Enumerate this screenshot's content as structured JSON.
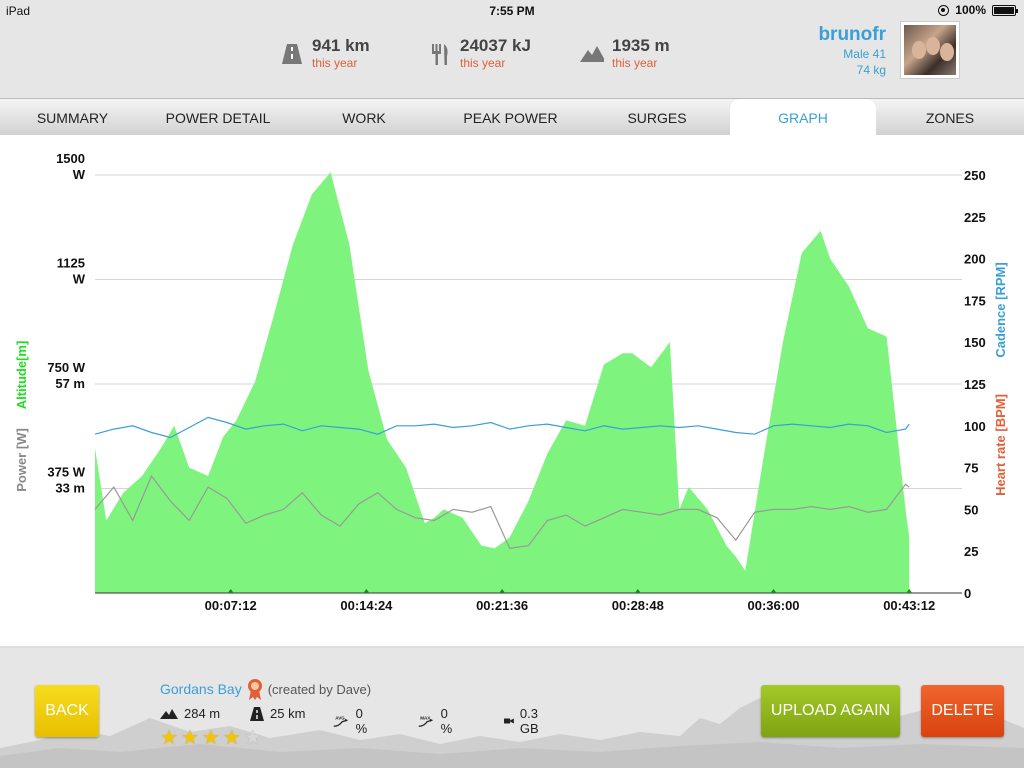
{
  "status_bar": {
    "device": "iPad",
    "time": "7:55 PM",
    "battery": "100%"
  },
  "header": {
    "stats": [
      {
        "icon": "road-icon",
        "value": "941 km",
        "sub": "this year"
      },
      {
        "icon": "fork-knife-icon",
        "value": "24037 kJ",
        "sub": "this year"
      },
      {
        "icon": "mountain-icon",
        "value": "1935 m",
        "sub": "this year"
      }
    ],
    "user": {
      "name": "brunofr",
      "line1": "Male 41",
      "line2": "74 kg"
    }
  },
  "tabs": [
    {
      "label": "SUMMARY",
      "active": false
    },
    {
      "label": "POWER DETAIL",
      "active": false
    },
    {
      "label": "WORK",
      "active": false
    },
    {
      "label": "PEAK POWER",
      "active": false
    },
    {
      "label": "SURGES",
      "active": false
    },
    {
      "label": "GRAPH",
      "active": true
    },
    {
      "label": "ZONES",
      "active": false
    }
  ],
  "chart_data": {
    "type": "area",
    "left_axis": {
      "titles": [
        {
          "text": "Altitude[m]",
          "color": "#22dd22"
        },
        {
          "text": "Power [W]",
          "color": "#888888"
        }
      ],
      "ticks": [
        {
          "value": 0,
          "labels": []
        },
        {
          "value": 375,
          "labels": [
            "375 W",
            "33 m"
          ]
        },
        {
          "value": 750,
          "labels": [
            "750 W",
            "57 m"
          ]
        },
        {
          "value": 1125,
          "labels": [
            "1125",
            "W"
          ]
        },
        {
          "value": 1500,
          "labels": [
            "1500",
            "W"
          ]
        }
      ],
      "ylim": [
        0,
        1500
      ]
    },
    "right_axis": {
      "titles": [
        {
          "text": "Cadence [RPM]",
          "color": "#3a9fd6"
        },
        {
          "text": "Heart rate [BPM]",
          "color": "#e0603a"
        }
      ],
      "ticks": [
        "0",
        "25",
        "50",
        "75",
        "100",
        "125",
        "150",
        "175",
        "200",
        "225",
        "250"
      ],
      "ylim": [
        0,
        250
      ]
    },
    "x_ticks": [
      "00:07:12",
      "00:14:24",
      "00:21:36",
      "00:28:48",
      "00:36:00",
      "00:43:12"
    ],
    "x_tick_minutes": [
      7.2,
      14.4,
      21.6,
      28.8,
      36.0,
      43.2
    ],
    "xlim_minutes": [
      0,
      46.0
    ],
    "grid": true,
    "series": [
      {
        "name": "Altitude",
        "kind": "area",
        "color": "#7ef47e",
        "scale": "left",
        "x_minutes": [
          0,
          0.6,
          1.5,
          2.5,
          3.5,
          4.2,
          5.0,
          6.0,
          6.8,
          7.5,
          8.5,
          9.5,
          10.5,
          11.5,
          12.5,
          13.5,
          14.5,
          15.5,
          16.5,
          17.5,
          18.0,
          18.5,
          19.5,
          20.5,
          21.2,
          22.0,
          23.0,
          24.0,
          25.0,
          26.0,
          27.0,
          28.0,
          28.5,
          29.5,
          30.5,
          31.0,
          31.5,
          32.5,
          33.5,
          34.0,
          34.5,
          35.5,
          36.5,
          37.5,
          38.5,
          39.0,
          40.0,
          41.0,
          42.0,
          43.0,
          43.2
        ],
        "y_watt_scale": [
          520,
          260,
          360,
          420,
          520,
          600,
          450,
          420,
          560,
          620,
          760,
          1000,
          1250,
          1430,
          1510,
          1250,
          800,
          550,
          450,
          250,
          270,
          300,
          270,
          170,
          160,
          200,
          330,
          500,
          620,
          600,
          820,
          860,
          860,
          810,
          900,
          300,
          380,
          300,
          170,
          130,
          80,
          500,
          900,
          1220,
          1300,
          1200,
          1100,
          950,
          920,
          300,
          200
        ]
      },
      {
        "name": "Cadence",
        "kind": "line",
        "color": "#3a9fd6",
        "scale": "right",
        "x_minutes": [
          0,
          1,
          2,
          3,
          4,
          5,
          6,
          7,
          8,
          9,
          10,
          11,
          12,
          13,
          14,
          15,
          16,
          17,
          18,
          19,
          20,
          21,
          22,
          23,
          24,
          25,
          26,
          27,
          28,
          29,
          30,
          31,
          32,
          33,
          34,
          35,
          36,
          37,
          38,
          39,
          40,
          41,
          42,
          43,
          43.2
        ],
        "y": [
          95,
          98,
          100,
          96,
          93,
          99,
          105,
          102,
          98,
          100,
          101,
          97,
          100,
          99,
          98,
          95,
          100,
          100,
          101,
          99,
          100,
          102,
          98,
          100,
          101,
          99,
          97,
          100,
          98,
          99,
          100,
          99,
          100,
          98,
          96,
          95,
          100,
          101,
          100,
          99,
          101,
          100,
          96,
          98,
          101
        ]
      },
      {
        "name": "Power",
        "kind": "line",
        "color": "#999999",
        "scale": "left",
        "x_minutes": [
          0,
          1,
          2,
          3,
          4,
          5,
          6,
          7,
          8,
          9,
          10,
          11,
          12,
          13,
          14,
          15,
          16,
          17,
          18,
          19,
          20,
          21,
          22,
          23,
          24,
          25,
          26,
          27,
          28,
          29,
          30,
          31,
          32,
          33,
          34,
          35,
          36,
          37,
          38,
          39,
          40,
          41,
          42,
          43,
          43.2
        ],
        "y": [
          300,
          380,
          260,
          420,
          330,
          260,
          380,
          340,
          250,
          280,
          300,
          360,
          280,
          240,
          320,
          360,
          300,
          270,
          260,
          300,
          290,
          310,
          160,
          170,
          260,
          280,
          240,
          270,
          300,
          290,
          280,
          300,
          300,
          270,
          190,
          290,
          300,
          300,
          310,
          300,
          310,
          290,
          300,
          390,
          380
        ]
      }
    ]
  },
  "footer": {
    "back_label": "BACK",
    "upload_label": "UPLOAD AGAIN",
    "delete_label": "DELETE",
    "route_name": "Gordans Bay",
    "creator": "(created by Dave)",
    "elevation": "284 m",
    "distance": "25 km",
    "avg_gradient": "0 %",
    "max_gradient": "0 %",
    "size": "0.3 GB",
    "rating": 4,
    "rating_max": 5,
    "icon_labels": {
      "avg": "AVG",
      "max": "MAX"
    }
  }
}
